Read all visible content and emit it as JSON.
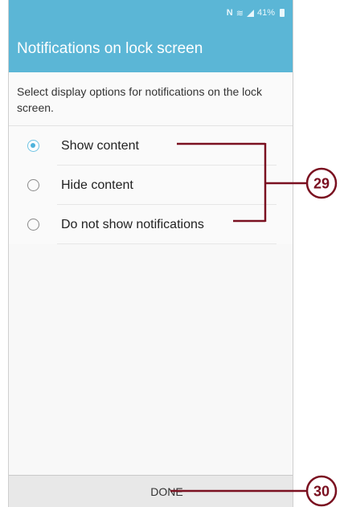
{
  "status_bar": {
    "nfc": "N",
    "battery": "41%"
  },
  "header": {
    "title": "Notifications on lock screen"
  },
  "description": "Select display options for notifications on the lock screen.",
  "options": [
    {
      "label": "Show content",
      "selected": true
    },
    {
      "label": "Hide content",
      "selected": false
    },
    {
      "label": "Do not show notifications",
      "selected": false
    }
  ],
  "footer": {
    "done_label": "DONE"
  },
  "callouts": {
    "options_step": "29",
    "done_step": "30"
  },
  "colors": {
    "accent": "#5bb6d6",
    "radio_selected": "#4fb3dc",
    "callout": "#7a1020"
  }
}
